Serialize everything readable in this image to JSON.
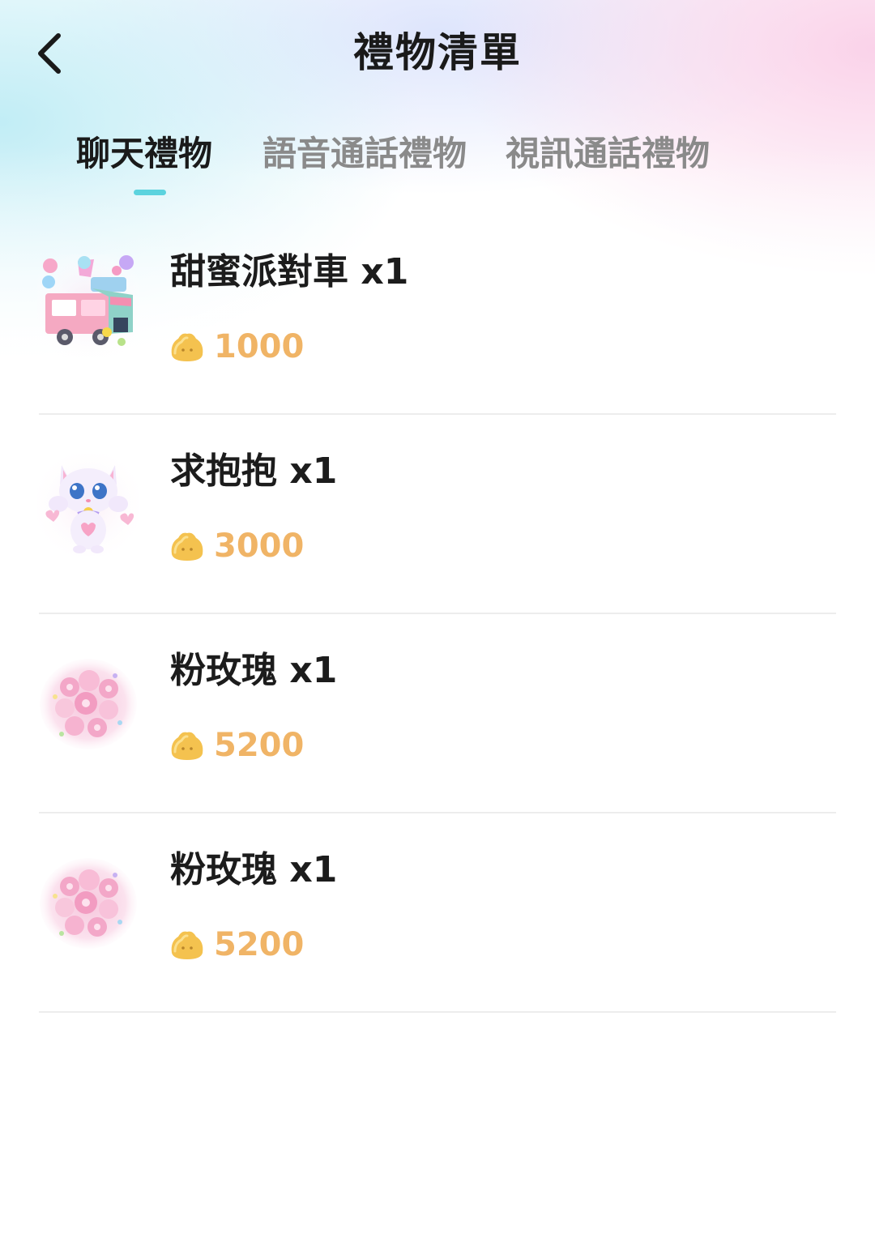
{
  "header": {
    "title": "禮物清單",
    "back_icon": "chevron-left-icon"
  },
  "tabs": [
    {
      "label": "聊天禮物",
      "active": true
    },
    {
      "label": "語音通話禮物",
      "active": false
    },
    {
      "label": "視訊通話禮物",
      "active": false
    }
  ],
  "colors": {
    "tab_indicator": "#5cd3de",
    "price": "#f0b466",
    "coin": "#f4c24f"
  },
  "gifts": [
    {
      "name": "甜蜜派對車 x1",
      "price": "1000",
      "image": "party-car-image"
    },
    {
      "name": "求抱抱 x1",
      "price": "3000",
      "image": "hug-cat-image"
    },
    {
      "name": "粉玫瑰 x1",
      "price": "5200",
      "image": "pink-rose-image"
    },
    {
      "name": "粉玫瑰 x1",
      "price": "5200",
      "image": "pink-rose-image"
    }
  ],
  "coin_icon": "coin-icon"
}
